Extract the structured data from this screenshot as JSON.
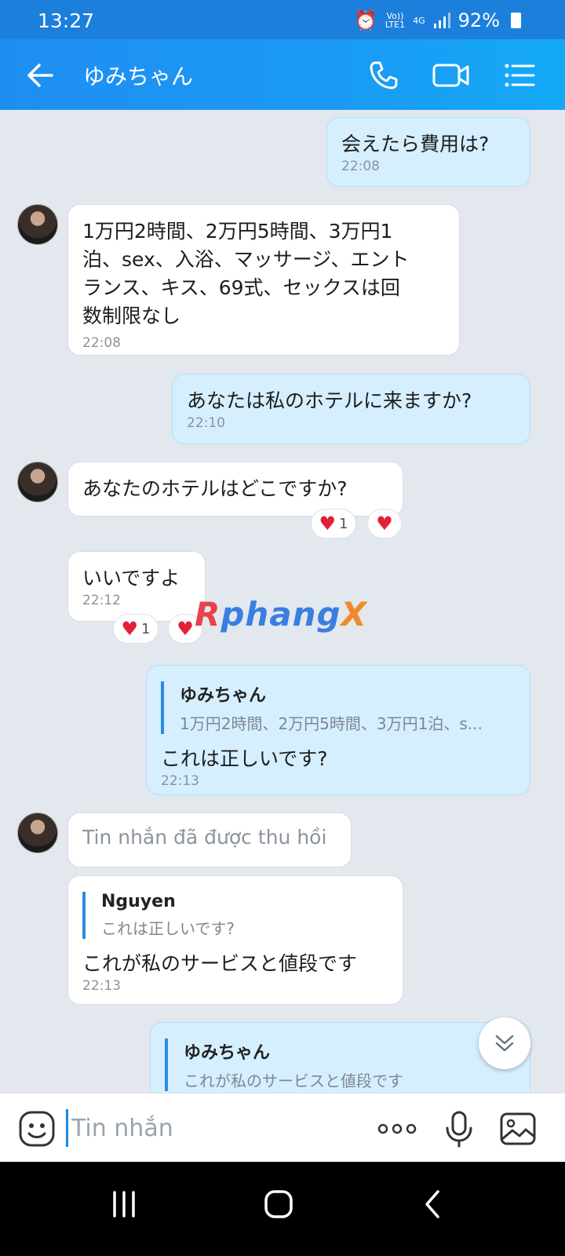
{
  "status_bar": {
    "time": "13:27",
    "network_top": "Vo))",
    "network_bottom": "LTE1",
    "network_type": "4G",
    "battery": "92%"
  },
  "header": {
    "title": "ゆみちゃん"
  },
  "messages": [
    {
      "text": "会えたら費用は?",
      "time": "22:08"
    },
    {
      "text_lines": [
        "1万円2時間、2万円5時間、3万円1",
        "泊、sex、入浴、マッサージ、エント",
        "ランス、キス、69式、セックスは回",
        "数制限なし"
      ],
      "time": "22:08"
    },
    {
      "text": "あなたは私のホテルに来ますか?",
      "time": "22:10"
    },
    {
      "text": "あなたのホテルはどこですか?",
      "reaction_count": "1"
    },
    {
      "text": "いいですよ",
      "time": "22:12",
      "reaction_count": "1"
    },
    {
      "quote_name": "ゆみちゃん",
      "quote_text": "1万円2時間、2万円5時間、3万円1泊、s...",
      "text": "これは正しいです?",
      "time": "22:13"
    },
    {
      "text": "Tin nhắn đã được thu hồi"
    },
    {
      "quote_name": "Nguyen",
      "quote_text": "これは正しいです?",
      "text": "これが私のサービスと値段です",
      "time": "22:13"
    },
    {
      "quote_name": "ゆみちゃん",
      "quote_text": "これが私のサービスと値段です"
    }
  ],
  "watermark": {
    "part1": "R",
    "part2": "phang",
    "part3": "X"
  },
  "composer": {
    "placeholder": "Tin nhắn"
  },
  "colors": {
    "header": "#1d8df0",
    "outgoing_bubble": "#d5efff",
    "incoming_bubble": "#ffffff",
    "background": "#e2e8ee",
    "heart": "#e2203a"
  },
  "icons": [
    "back-arrow-icon",
    "phone-icon",
    "video-call-icon",
    "menu-list-icon",
    "emoji-sticker-icon",
    "more-options-icon",
    "microphone-icon",
    "image-icon",
    "scroll-down-icon",
    "heart-icon",
    "recent-apps-icon",
    "home-icon",
    "nav-back-icon"
  ]
}
